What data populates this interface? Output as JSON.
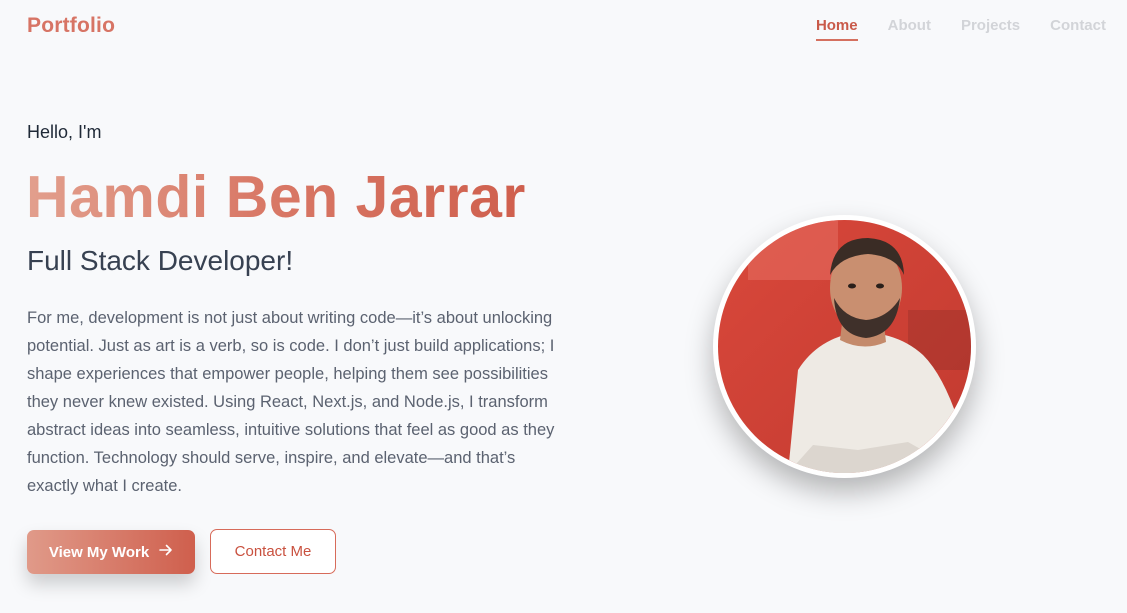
{
  "nav": {
    "brand": "Portfolio",
    "links": [
      "Home",
      "About",
      "Projects",
      "Contact"
    ],
    "active": "Home"
  },
  "hero": {
    "greeting": "Hello, I'm",
    "name": "Hamdi Ben Jarrar",
    "role": "Full Stack Developer!",
    "bio": "For me, development is not just about writing code—it’s about unlocking potential. Just as art is a verb, so is code. I don’t just build applications; I shape experiences that empower people, helping them see possibilities they never knew existed. Using React, Next.js, and Node.js, I transform abstract ideas into seamless, intuitive solutions that feel as good as they function. Technology should serve, inspire, and elevate—and that’s exactly what I create.",
    "primary_button": "View My Work",
    "secondary_button": "Contact Me",
    "primary_icon": "arrow-right-icon"
  },
  "colors": {
    "accent": "#d5705f",
    "accent_dark": "#c9513f",
    "background": "#f8f9fb",
    "nav_inactive": "#d2d4d8"
  }
}
